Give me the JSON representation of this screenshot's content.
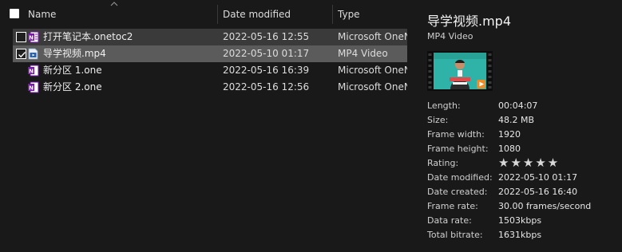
{
  "header": {
    "name_label": "Name",
    "date_label": "Date modified",
    "type_label": "Type"
  },
  "files": [
    {
      "name": "打开笔记本.onetoc2",
      "date": "2022-05-16 12:55",
      "type": "Microsoft OneNote",
      "icon": "onenote-toc-icon",
      "checked": false,
      "selected": true
    },
    {
      "name": "导学视频.mp4",
      "date": "2022-05-10 01:17",
      "type": "MP4 Video",
      "icon": "video-file-icon",
      "checked": true,
      "selected": true
    },
    {
      "name": "新分区 1.one",
      "date": "2022-05-16 16:39",
      "type": "Microsoft OneNote",
      "icon": "onenote-section-icon",
      "checked": false,
      "selected": false
    },
    {
      "name": "新分区 2.one",
      "date": "2022-05-16 12:56",
      "type": "Microsoft OneNote",
      "icon": "onenote-section-icon",
      "checked": false,
      "selected": false
    }
  ],
  "details": {
    "title": "导学视频.mp4",
    "subtitle": "MP4 Video",
    "rating_stars": 5,
    "rating_glyphs": "★★★★★",
    "properties": [
      {
        "label": "Length:",
        "value": "00:04:07"
      },
      {
        "label": "Size:",
        "value": "48.2 MB"
      },
      {
        "label": "Frame width:",
        "value": "1920"
      },
      {
        "label": "Frame height:",
        "value": "1080"
      },
      {
        "label": "Rating:",
        "value": ""
      },
      {
        "label": "Date modified:",
        "value": "2022-05-10 01:17"
      },
      {
        "label": "Date created:",
        "value": "2022-05-16 16:40"
      },
      {
        "label": "Frame rate:",
        "value": "30.00 frames/second"
      },
      {
        "label": "Data rate:",
        "value": "1503kbps"
      },
      {
        "label": "Total bitrate:",
        "value": "1631kbps"
      }
    ]
  },
  "colors": {
    "background": "#191919",
    "selected_row": "#3a3a3a",
    "hover_row": "#5b5b5b",
    "onenote_purple": "#7719aa",
    "thumb_teal": "#2fb3a8",
    "play_orange": "#f08a24"
  }
}
